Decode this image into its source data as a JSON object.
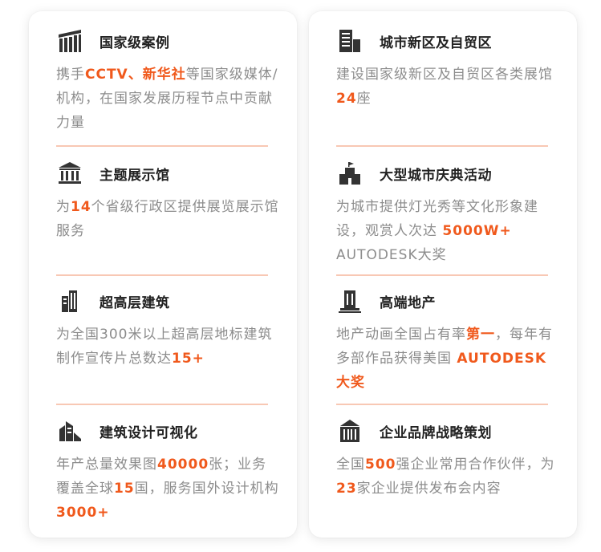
{
  "accent_color": "#f0591c",
  "left": {
    "items": [
      {
        "icon": "building-columns-icon",
        "title": "国家级案例",
        "desc": [
          {
            "t": "携手",
            "h": false
          },
          {
            "t": "CCTV、新华社",
            "h": true
          },
          {
            "t": "等国家级媒体/机构，在国家发展历程节点中贡献力量",
            "h": false
          }
        ]
      },
      {
        "icon": "museum-icon",
        "title": "主题展示馆",
        "desc": [
          {
            "t": "为",
            "h": false
          },
          {
            "t": "14",
            "h": true
          },
          {
            "t": "个省级行政区提供展览展示馆服务",
            "h": false
          }
        ]
      },
      {
        "icon": "skyscraper-icon",
        "title": "超高层建筑",
        "desc": [
          {
            "t": "为全国300米以上超高层地标建筑制作宣传片总数达",
            "h": false
          },
          {
            "t": "15+",
            "h": true
          }
        ]
      },
      {
        "icon": "architecture-viz-icon",
        "title": "建筑设计可视化",
        "desc": [
          {
            "t": "年产总量效果图",
            "h": false
          },
          {
            "t": "40000",
            "h": true
          },
          {
            "t": "张；业务覆盖全球",
            "h": false
          },
          {
            "t": "15",
            "h": true
          },
          {
            "t": "国，服务国外设计机构",
            "h": false
          },
          {
            "t": "3000+",
            "h": true
          }
        ]
      }
    ]
  },
  "right": {
    "items": [
      {
        "icon": "city-tower-icon",
        "title": "城市新区及自贸区",
        "desc": [
          {
            "t": "建设国家级新区及自贸区各类展馆",
            "h": false
          },
          {
            "t": "24",
            "h": true
          },
          {
            "t": "座",
            "h": false
          }
        ]
      },
      {
        "icon": "city-event-icon",
        "title": "大型城市庆典活动",
        "desc": [
          {
            "t": "为城市提供灯光秀等文化形象建设，观赏人次达 ",
            "h": false
          },
          {
            "t": "5000W+",
            "h": true
          },
          {
            "t": " AUTODESK大奖",
            "h": false
          }
        ]
      },
      {
        "icon": "real-estate-icon",
        "title": "高端地产",
        "desc": [
          {
            "t": "地产动画全国占有率",
            "h": false
          },
          {
            "t": "第一",
            "h": true
          },
          {
            "t": "，每年有多部作品获得美国 ",
            "h": false
          },
          {
            "t": "AUTODESK大奖",
            "h": true
          }
        ]
      },
      {
        "icon": "enterprise-building-icon",
        "title": "企业品牌战略策划",
        "desc": [
          {
            "t": "全国",
            "h": false
          },
          {
            "t": "500",
            "h": true
          },
          {
            "t": "强企业常用合作伙伴，为",
            "h": false
          },
          {
            "t": "23",
            "h": true
          },
          {
            "t": "家企业提供发布会内容",
            "h": false
          }
        ]
      }
    ]
  }
}
